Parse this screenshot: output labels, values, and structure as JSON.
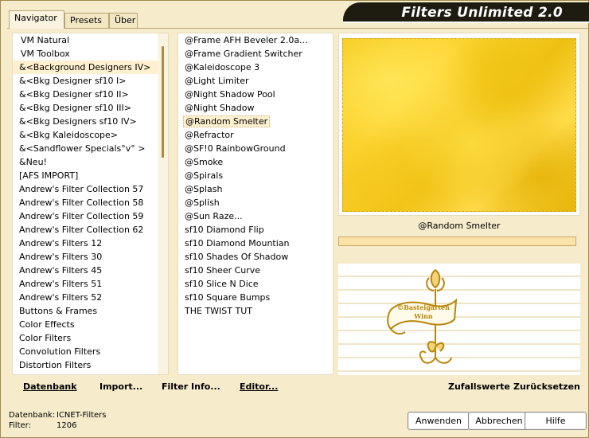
{
  "app": {
    "title": "Filters Unlimited 2.0"
  },
  "tabs": [
    {
      "label": "Navigator"
    },
    {
      "label": "Presets"
    },
    {
      "label": "Über"
    }
  ],
  "categories": [
    "VM Natural",
    "VM Toolbox",
    "&<Background Designers IV>",
    "&<Bkg Designer sf10 I>",
    "&<Bkg Designer sf10 II>",
    "&<Bkg Designer sf10 III>",
    "&<Bkg Designers sf10 IV>",
    "&<Bkg Kaleidoscope>",
    "&<Sandflower Specials°v° >",
    "&Neu!",
    "[AFS IMPORT]",
    "Andrew's Filter Collection 57",
    "Andrew's Filter Collection 58",
    "Andrew's Filter Collection 59",
    "Andrew's Filter Collection 62",
    "Andrew's Filters 12",
    "Andrew's Filters 30",
    "Andrew's Filters 45",
    "Andrew's Filters 51",
    "Andrew's Filters 52",
    "Buttons & Frames",
    "Color Effects",
    "Color Filters",
    "Convolution Filters",
    "Distortion Filters"
  ],
  "selected_category": "&<Background Designers IV>",
  "filters": [
    "@Frame AFH Beveler 2.0a...",
    "@Frame Gradient Switcher",
    "@Kaleidoscope 3",
    "@Light Limiter",
    "@Night Shadow Pool",
    "@Night Shadow",
    "@Random Smelter",
    "@Refractor",
    "@SF!0 RainbowGround",
    "@Smoke",
    "@Spirals",
    "@Splash",
    "@Splish",
    "@Sun Raze...",
    "sf10 Diamond Flip",
    "sf10 Diamond Mountian",
    "sf10 Shades Of Shadow",
    "sf10 Sheer Curve",
    "sf10 Slice N Dice",
    "sf10 Square Bumps",
    "THE TWIST TUT"
  ],
  "selected_filter": "@Random Smelter",
  "preview": {
    "filter_name": "@Random Smelter",
    "logo_text_line1": "©Bastelgarten",
    "logo_text_line2": "Winn"
  },
  "toolbar": {
    "database_label": "Datenbank",
    "import_label": "Import...",
    "filter_info_label": "Filter Info...",
    "editor_label": "Editor...",
    "random_label": "Zufallswerte",
    "reset_label": "Zurücksetzen"
  },
  "status": {
    "database_key": "Datenbank:",
    "database_value": "ICNET-Filters",
    "filter_key": "Filter:",
    "filter_value": "1206"
  },
  "buttons": {
    "apply": "Anwenden",
    "cancel": "Abbrechen",
    "help": "Hilfe"
  },
  "colors": {
    "background": "#f6ebcb",
    "accent_gold": "#b8860b",
    "preview_yellow": "#f5c91a",
    "title_bar": "#1e1b10"
  }
}
